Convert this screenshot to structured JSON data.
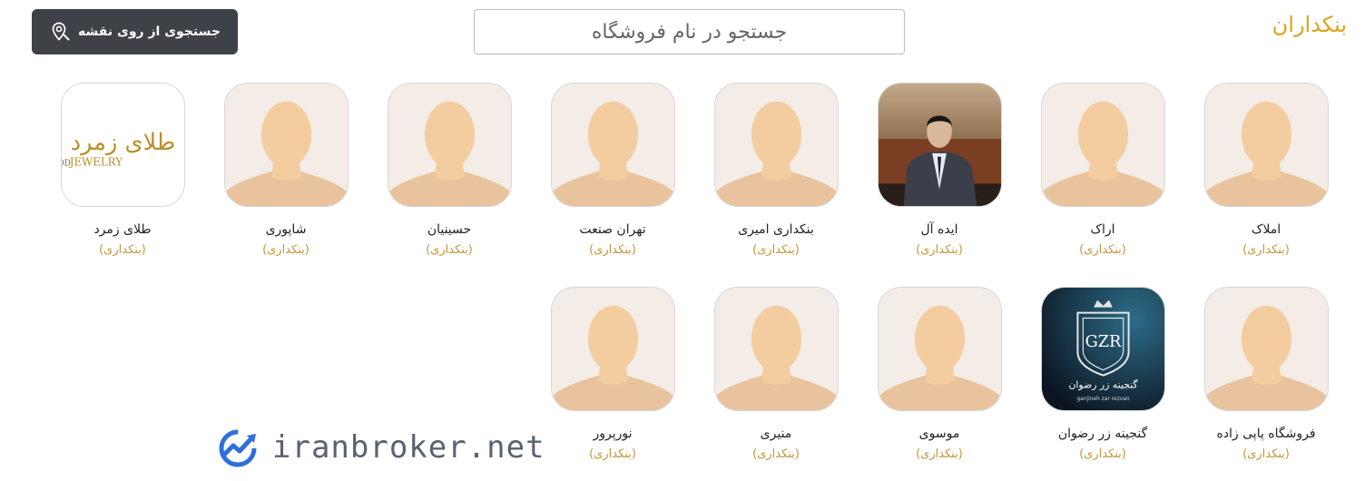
{
  "header": {
    "title": "بنکداران",
    "search": {
      "placeholder": "جستجو در نام فروشگاه",
      "value": ""
    },
    "map_button": {
      "label": "جستجوی از روی نقشه",
      "icon": "map-pin-search-icon"
    }
  },
  "stores": [
    {
      "name": "املاک",
      "category": "(بنکداری)",
      "avatar": "default-avatar"
    },
    {
      "name": "اراک",
      "category": "(بنکداری)",
      "avatar": "default-avatar"
    },
    {
      "name": "ایده آل",
      "category": "(بنکداری)",
      "avatar": "store-owner-photo"
    },
    {
      "name": "بنکداری امیری",
      "category": "(بنکداری)",
      "avatar": "default-avatar"
    },
    {
      "name": "تهران صنعت",
      "category": "(بنکداری)",
      "avatar": "default-avatar"
    },
    {
      "name": "حسینیان",
      "category": "(بنکداری)",
      "avatar": "default-avatar"
    },
    {
      "name": "شاپوری",
      "category": "(بنکداری)",
      "avatar": "default-avatar"
    },
    {
      "name": "طلای زمرد",
      "category": "(بنکداری)",
      "avatar": "zomorod-jewelry-logo",
      "logo_text": {
        "fa": "طلای زمرد",
        "en_left": "ZOMOROD",
        "en_right": "JEWELRY"
      }
    },
    {
      "name": "فروشگاه پاپی زاده",
      "category": "(بنکداری)",
      "avatar": "default-avatar"
    },
    {
      "name": "گنجینه زر رضوان",
      "category": "(بنکداری)",
      "avatar": "ganjineh-zar-logo",
      "logo_text": {
        "fa": "گنجینه زر رضوان",
        "en": "ganjineh zar rezvan",
        "monogram": "GZR"
      }
    },
    {
      "name": "موسوی",
      "category": "(بنکداری)",
      "avatar": "default-avatar"
    },
    {
      "name": "منیری",
      "category": "(بنکداری)",
      "avatar": "default-avatar"
    },
    {
      "name": "نورپرور",
      "category": "(بنکداری)",
      "avatar": "default-avatar"
    }
  ],
  "watermark": {
    "text": "iranbroker.net",
    "icon": "growth-chart-icon"
  },
  "colors": {
    "accent": "#d9a521",
    "category": "#c8953a",
    "button_bg": "#3f4148",
    "avatar_bg": "#f4ece6",
    "avatar_skin": "#f3cda0",
    "avatar_shoulders": "#e8c39d"
  }
}
